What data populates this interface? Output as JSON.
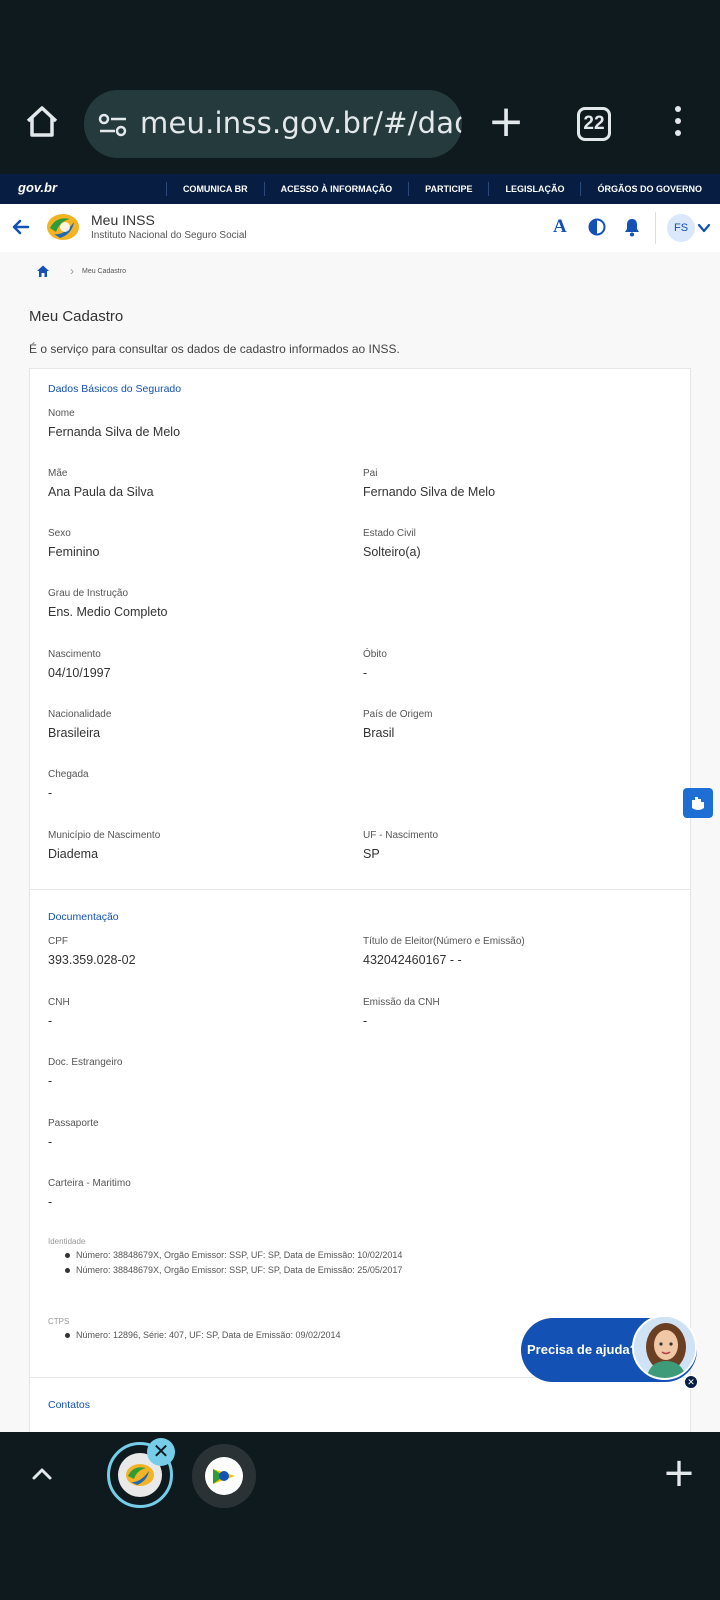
{
  "browser": {
    "url": "meu.inss.gov.br/#/dados",
    "tab_count": "22"
  },
  "gov_bar": {
    "logo": "gov.br",
    "links": [
      "COMUNICA BR",
      "ACESSO À INFORMAÇÃO",
      "PARTICIPE",
      "LEGISLAÇÃO",
      "ÓRGÃOS DO GOVERNO"
    ]
  },
  "header": {
    "title": "Meu INSS",
    "subtitle": "Instituto Nacional do Seguro Social",
    "font_button": "A",
    "avatar_initials": "FS"
  },
  "breadcrumb": {
    "current": "Meu Cadastro"
  },
  "page": {
    "title": "Meu Cadastro",
    "description": "É o serviço para consultar os dados de cadastro informados ao INSS."
  },
  "basic": {
    "title": "Dados Básicos do Segurado",
    "nome": {
      "label": "Nome",
      "value": "Fernanda Silva de Melo"
    },
    "mae": {
      "label": "Mãe",
      "value": "Ana Paula da Silva"
    },
    "pai": {
      "label": "Pai",
      "value": "Fernando Silva de Melo"
    },
    "sexo": {
      "label": "Sexo",
      "value": "Feminino"
    },
    "estado_civil": {
      "label": "Estado Civil",
      "value": "Solteiro(a)"
    },
    "grau": {
      "label": "Grau de Instrução",
      "value": "Ens. Medio Completo"
    },
    "nascimento": {
      "label": "Nascimento",
      "value": "04/10/1997"
    },
    "obito": {
      "label": "Óbito",
      "value": "-"
    },
    "nacionalidade": {
      "label": "Nacionalidade",
      "value": "Brasileira"
    },
    "pais_origem": {
      "label": "País de Origem",
      "value": "Brasil"
    },
    "chegada": {
      "label": "Chegada",
      "value": "-"
    },
    "municipio": {
      "label": "Município de Nascimento",
      "value": "Diadema"
    },
    "uf": {
      "label": "UF - Nascimento",
      "value": "SP"
    }
  },
  "docs": {
    "title": "Documentação",
    "cpf": {
      "label": "CPF",
      "value": "393.359.028-02"
    },
    "titulo": {
      "label": "Título de Eleitor(Número e Emissão)",
      "value": "432042460167 - -"
    },
    "cnh": {
      "label": "CNH",
      "value": "-"
    },
    "emissao_cnh": {
      "label": "Emissão da CNH",
      "value": "-"
    },
    "doc_estrangeiro": {
      "label": "Doc. Estrangeiro",
      "value": "-"
    },
    "passaporte": {
      "label": "Passaporte",
      "value": "-"
    },
    "carteira_maritimo": {
      "label": "Carteira - Maritimo",
      "value": "-"
    },
    "identidade_label": "Identidade",
    "identidade": [
      "Número: 38848679X, Orgão Emissor: SSP, UF: SP, Data de Emissão: 10/02/2014",
      "Número: 38848679X, Orgão Emissor: SSP, UF: SP, Data de Emissão: 25/05/2017"
    ],
    "ctps_label": "CTPS",
    "ctps": [
      "Número: 12896, Série: 407, UF: SP, Data de Emissão: 09/02/2014"
    ]
  },
  "contatos": {
    "title": "Contatos"
  },
  "help": {
    "label": "Precisa de ajuda?"
  },
  "colors": {
    "primary": "#1351b4",
    "gov_bar": "#071d41",
    "chrome": "#0f1a1f",
    "url_pill": "#253a3d",
    "tab_accent": "#76cde8"
  }
}
